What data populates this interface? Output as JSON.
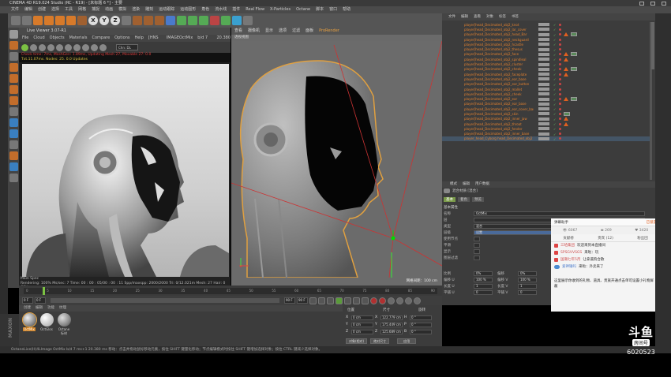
{
  "window": {
    "title": "CINEMA 4D R19.024 Studio (RC - R19) - [未标题 6 *] - 主要"
  },
  "menubar": {
    "items": [
      "文件",
      "编辑",
      "创建",
      "选择",
      "工具",
      "网格",
      "捕捉",
      "动画",
      "模拟",
      "渲染",
      "雕刻",
      "运动跟踪",
      "运动图形",
      "角色",
      "流水线",
      "插件",
      "Real Flow",
      "X-Particles",
      "Octane",
      "脚本",
      "窗口",
      "帮助"
    ]
  },
  "toolbar": {
    "axis_labels": [
      "X",
      "Y",
      "Z"
    ]
  },
  "live_viewer": {
    "header": "Live Viewer 3.07-R1",
    "menu": [
      "File",
      "Cloud",
      "Objects",
      "Materials",
      "Compare",
      "Options",
      "Help",
      "[HNS HDR]",
      "IMAGEOctMix",
      "b/d 7 ms+1",
      "20.380 ms"
    ],
    "channel_select": "Chn: DL",
    "status_red": "Check time: 7ms, MeshGen: 1.89ms, Updating Mesh 27, Movable 27: 0.0",
    "status_yellow": "Txt.11.07ms. Nodes: 25. 0.0  Updates",
    "foot_line1": "Main  Spec",
    "foot_line2": "Rendering: 100%   Ms/sec: 7   Time: 00 : 00 : 05/00 : 00 : 11   Spp/maxspp: 2000/2000   Tri: 0/12.021m   Mesh: 27   Hair: 0   GPU"
  },
  "viewport": {
    "menu": [
      "查看",
      "摄像机",
      "显示",
      "选项",
      "过滤",
      "面板",
      "ProRender"
    ],
    "sub": "透视视图",
    "grid_label": "网格间距：100 cm"
  },
  "object_manager": {
    "tabs": [
      "文件",
      "编辑",
      "查看",
      "对象",
      "标签",
      "书签"
    ],
    "rows": [
      {
        "name": "player[head_Decimated_obj2_knot"
      },
      {
        "name": "player[head_Decimated_obj2_lar_cover"
      },
      {
        "name": "player[head_Decimated_obj2_head_Bar"
      },
      {
        "name": "player[head_Decimated_obj2_neckguard"
      },
      {
        "name": "player[head_Decimated_obj2_hcastle"
      },
      {
        "name": "player[head_Decimated_obj2_thesus"
      },
      {
        "name": "player[head_Decimated_obj2_face"
      },
      {
        "name": "player[head_Decimated_obj2_spindleal"
      },
      {
        "name": "player[head_Decimated_obj2_cluster"
      },
      {
        "name": "player[head_Decimated_obj2_cheek"
      },
      {
        "name": "player[head_Decimated_obj2_faceplate"
      },
      {
        "name": "player[head_Decimated_obj2_ear_base"
      },
      {
        "name": "player[head_Decimated_obj2_ear_button"
      },
      {
        "name": "player[head_Decimated_obj2_mallet"
      },
      {
        "name": "player[head_Decimated_obj2_cheek"
      },
      {
        "name": "player[head_Decimated_obj2_ear"
      },
      {
        "name": "player[head_Decimated_obj2_ear_base"
      },
      {
        "name": "player[head_Decimated_obj2_ear_cover_base"
      },
      {
        "name": "player[head_Decimated_obj2_skin"
      },
      {
        "name": "player[head_Decimated_obj2_inner_jaw"
      },
      {
        "name": "player[head_Decimated_obj2_throat"
      },
      {
        "name": "player[head_Decimated_obj2_fender"
      },
      {
        "name": "player[head_Decimated_obj2_inner_base"
      },
      {
        "name": "player_head_Cyborg head_Decimated_obj2"
      }
    ]
  },
  "attribute_manager": {
    "tabs": [
      "模式",
      "编辑",
      "用户数据"
    ],
    "title": "混合材质 [混合]",
    "subtabs": [
      "基本",
      "着色",
      "预览"
    ],
    "section": "基本属性",
    "fields": [
      {
        "label": "名称",
        "value": "OctMix"
      },
      {
        "label": "层",
        "value": ""
      },
      {
        "label": "类型",
        "value": "混合"
      },
      {
        "label": "层级",
        "value": "设置"
      },
      {
        "label": "使用节点",
        "value": ""
      },
      {
        "label": "平滑",
        "value": ""
      },
      {
        "label": "显示",
        "value": ""
      },
      {
        "label": "图层过滤",
        "value": ""
      }
    ],
    "pct_rows": [
      {
        "label": "比例",
        "value": "0%",
        "label2": "偏移",
        "value2": "0%"
      },
      {
        "label": "偏移 U",
        "value": "100 %",
        "label2": "偏移 V",
        "value2": "100 %"
      },
      {
        "label": "长度 U",
        "value": "1",
        "label2": "长度 V",
        "value2": "1"
      },
      {
        "label": "平铺 U",
        "value": "0",
        "label2": "平铺 V",
        "value2": "0"
      }
    ]
  },
  "chat": {
    "title": "弹幕助手",
    "pin": "已锁定",
    "stats": [
      "6067",
      "269",
      "3420"
    ],
    "nav": [
      "贡献榜",
      "贵宾 (12)",
      "粉丝团"
    ],
    "messages": [
      {
        "user": "三哈集团",
        "text": "欢迎来到本直播间",
        "style": "red"
      },
      {
        "user": "SPSGVVSGS",
        "text": "来啦：玩",
        "style": "red"
      },
      {
        "user": "国潮七年5月",
        "text": "让拿逼狗合散",
        "style": "red"
      },
      {
        "user": "爱神锤吗",
        "text": "来啦：外卖来了",
        "style": "blue"
      }
    ],
    "notice": "这里展示你收到的礼物、道具、贵族开通点击单可设置小礼物屏蔽"
  },
  "timeline": {
    "marks": [
      "0",
      "5",
      "10",
      "15",
      "20",
      "25",
      "30",
      "35",
      "40",
      "45",
      "50",
      "55",
      "60",
      "65",
      "70",
      "75",
      "80",
      "85",
      "90"
    ],
    "start": "0 F",
    "current": "0 F",
    "end": "90 F",
    "end2": "90 F"
  },
  "material_manager": {
    "tabs": [
      "创建",
      "编辑",
      "功能",
      "纹理"
    ],
    "materials": [
      {
        "name": "OctMix"
      },
      {
        "name": "OctGlos"
      },
      {
        "name": "Octane标材"
      }
    ]
  },
  "coordinates": {
    "headers": [
      "位置",
      "尺寸",
      "旋转"
    ],
    "rows": [
      {
        "axis": "X",
        "pos": "0 cm",
        "size": "122.779 cm",
        "rot_axis": "H",
        "rot": "0 °"
      },
      {
        "axis": "Y",
        "pos": "0 cm",
        "size": "175.449 cm",
        "rot_axis": "P",
        "rot": "0 °"
      },
      {
        "axis": "Z",
        "pos": "0 cm",
        "size": "125.689 cm",
        "rot_axis": "B",
        "rot": "0 °"
      }
    ],
    "mode": "对象(相对)",
    "size_mode": "绝对尺寸",
    "apply": "应用"
  },
  "statusbar": {
    "text": "OctaneLive(H)4LImage OctMix  b/d 7 ms+1  20.380 ms    移动：点击并拖动鼠标移动元素，按住 SHIFT 键量化移动；节点编辑模式时按住 SHIFT 键增加选择对象；按住 CTRL 键减少选择对象。"
  },
  "watermark": {
    "logo": "斗鱼",
    "sub": "房间号",
    "room": "6020523"
  }
}
